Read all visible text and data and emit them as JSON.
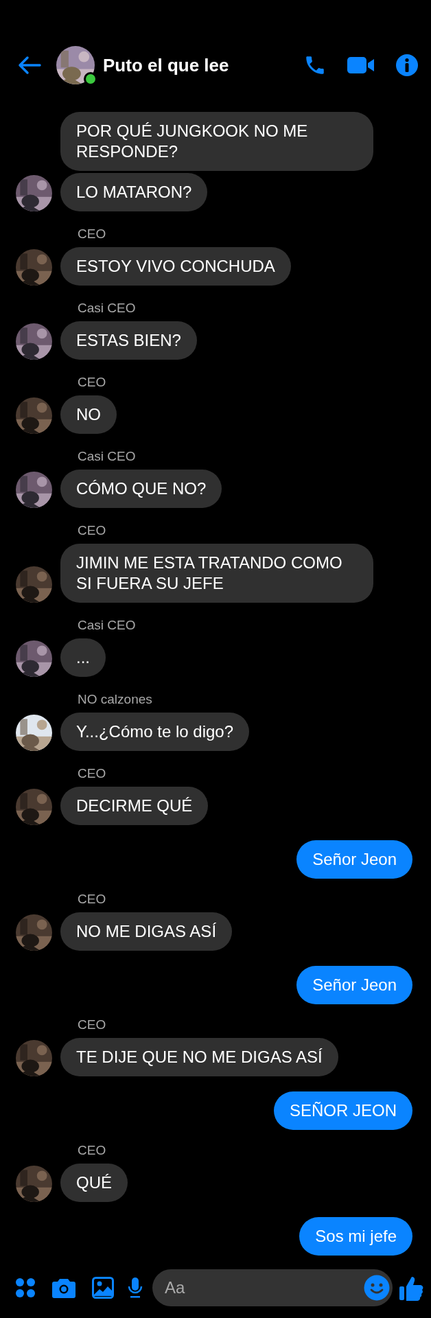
{
  "header": {
    "title": "Puto el que lee",
    "online": true
  },
  "groups": [
    {
      "kind": "incoming",
      "messages": [
        "POR QUÉ JUNGKOOK NO ME RESPONDE?",
        "LO MATARON?"
      ]
    },
    {
      "kind": "incoming",
      "sender": "CEO",
      "messages": [
        "ESTOY VIVO CONCHUDA"
      ]
    },
    {
      "kind": "incoming",
      "sender": "Casi CEO",
      "messages": [
        "ESTAS BIEN?"
      ]
    },
    {
      "kind": "incoming",
      "sender": "CEO",
      "messages": [
        "NO"
      ]
    },
    {
      "kind": "incoming",
      "sender": "Casi CEO",
      "messages": [
        "CÓMO QUE NO?"
      ]
    },
    {
      "kind": "incoming",
      "sender": "CEO",
      "messages": [
        "JIMIN ME ESTA TRATANDO COMO SI FUERA SU JEFE"
      ]
    },
    {
      "kind": "incoming",
      "sender": "Casi CEO",
      "messages": [
        "..."
      ]
    },
    {
      "kind": "incoming",
      "sender": "NO calzones",
      "messages": [
        "Y...¿Cómo te lo digo?"
      ]
    },
    {
      "kind": "incoming",
      "sender": "CEO",
      "messages": [
        "DECIRME QUÉ"
      ]
    },
    {
      "kind": "outgoing",
      "messages": [
        "Señor Jeon"
      ]
    },
    {
      "kind": "incoming",
      "sender": "CEO",
      "messages": [
        "NO ME DIGAS ASÍ"
      ]
    },
    {
      "kind": "outgoing",
      "messages": [
        "Señor Jeon"
      ]
    },
    {
      "kind": "incoming",
      "sender": "CEO",
      "messages": [
        "TE DIJE QUE NO ME DIGAS ASÍ"
      ]
    },
    {
      "kind": "outgoing",
      "messages": [
        "SEÑOR JEON"
      ]
    },
    {
      "kind": "incoming",
      "sender": "CEO",
      "messages": [
        "QUÉ"
      ]
    },
    {
      "kind": "outgoing",
      "messages": [
        "Sos mi jefe"
      ]
    }
  ],
  "composer": {
    "placeholder": "Aa"
  }
}
